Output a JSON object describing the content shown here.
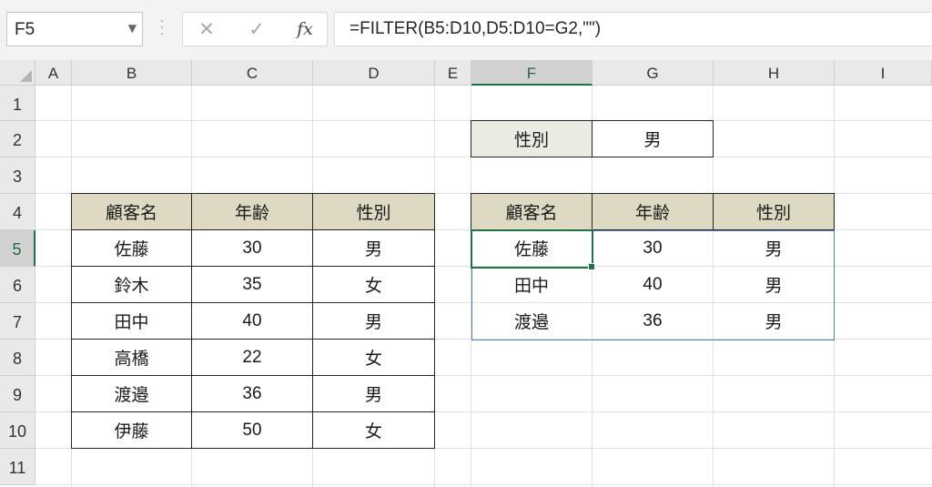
{
  "name_box": {
    "value": "F5"
  },
  "formula_bar": {
    "cancel_icon": "✕",
    "enter_icon": "✓",
    "fx_label": "fx",
    "formula": "=FILTER(B5:D10,D5:D10=G2,\"\")"
  },
  "columns": [
    "A",
    "B",
    "C",
    "D",
    "E",
    "F",
    "G",
    "H",
    "I"
  ],
  "rows": [
    "1",
    "2",
    "3",
    "4",
    "5",
    "6",
    "7",
    "8",
    "9",
    "10",
    "11"
  ],
  "selected_cell": {
    "column": "F",
    "row": "5"
  },
  "source_table": {
    "headers": [
      "顧客名",
      "年齢",
      "性別"
    ],
    "rows": [
      [
        "佐藤",
        "30",
        "男"
      ],
      [
        "鈴木",
        "35",
        "女"
      ],
      [
        "田中",
        "40",
        "男"
      ],
      [
        "高橋",
        "22",
        "女"
      ],
      [
        "渡邉",
        "36",
        "男"
      ],
      [
        "伊藤",
        "50",
        "女"
      ]
    ]
  },
  "criteria": {
    "label": "性別",
    "value": "男"
  },
  "result_table": {
    "headers": [
      "顧客名",
      "年齢",
      "性別"
    ],
    "rows": [
      [
        "佐藤",
        "30",
        "男"
      ],
      [
        "田中",
        "40",
        "男"
      ],
      [
        "渡邉",
        "36",
        "男"
      ]
    ]
  },
  "colors": {
    "header_fill": "#ddd9c3",
    "label_fill": "#ebeae3",
    "selection": "#217346",
    "spill_border": "#4f81bd"
  }
}
